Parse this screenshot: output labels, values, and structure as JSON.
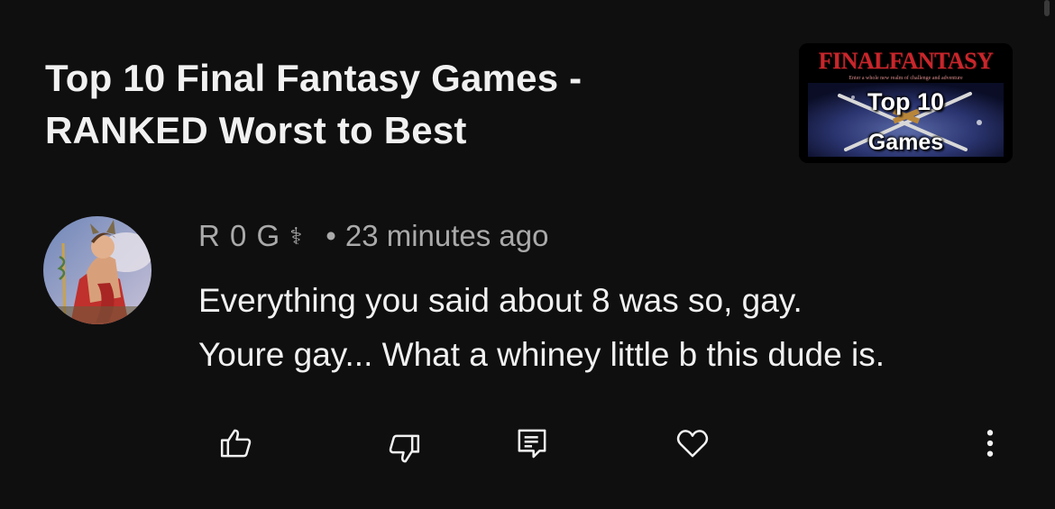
{
  "video": {
    "title_line1": "Top 10 Final Fantasy Games -",
    "title_line2": "RANKED Worst to Best",
    "thumbnail": {
      "logo_text": "FINALFANTASY",
      "tagline": "Enter a whole new realm of challenge and adventure",
      "caption_top": "Top 10",
      "caption_bottom": "Games"
    }
  },
  "comment": {
    "author": "R 0 G",
    "author_badge": "⚕",
    "separator": "•",
    "time": "23 minutes ago",
    "text_line1": "Everything you said about 8 was so, gay.",
    "text_line2": "Youre gay... What a whiney little b this dude is.",
    "actions": [
      "like-icon",
      "dislike-icon",
      "reply-icon",
      "heart-icon",
      "more-vertical-icon"
    ]
  },
  "colors": {
    "background": "#0f0f0f",
    "primary_text": "#f1f1f1",
    "secondary_text": "#aaaaaa",
    "logo_red": "#c8262b"
  }
}
